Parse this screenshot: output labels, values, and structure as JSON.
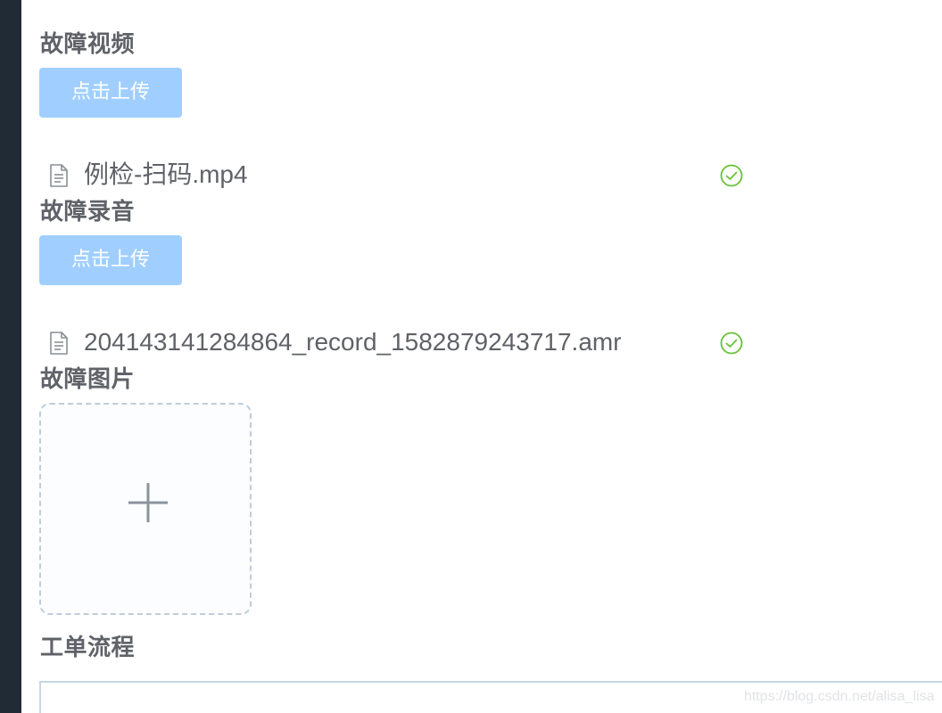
{
  "sections": {
    "video": {
      "title": "故障视频",
      "upload_label": "点击上传",
      "file": {
        "name": "例检-扫码.mp4",
        "status_icon": "circle-check-icon"
      }
    },
    "audio": {
      "title": "故障录音",
      "upload_label": "点击上传",
      "file": {
        "name": "204143141284864_record_1582879243717.amr",
        "status_icon": "circle-check-icon"
      }
    },
    "picture": {
      "title": "故障图片",
      "add_icon": "plus-icon"
    },
    "workflow": {
      "title": "工单流程"
    }
  },
  "icons": {
    "file": "document-icon",
    "success": "circle-check-icon",
    "add": "plus-icon"
  },
  "colors": {
    "sidebar": "#212b36",
    "upload_button_disabled": "#a0cfff",
    "success": "#67c23a",
    "title_text": "#5f6268",
    "dashed_border": "#c0ccda"
  },
  "watermark": "https://blog.csdn.net/alisa_lisa"
}
